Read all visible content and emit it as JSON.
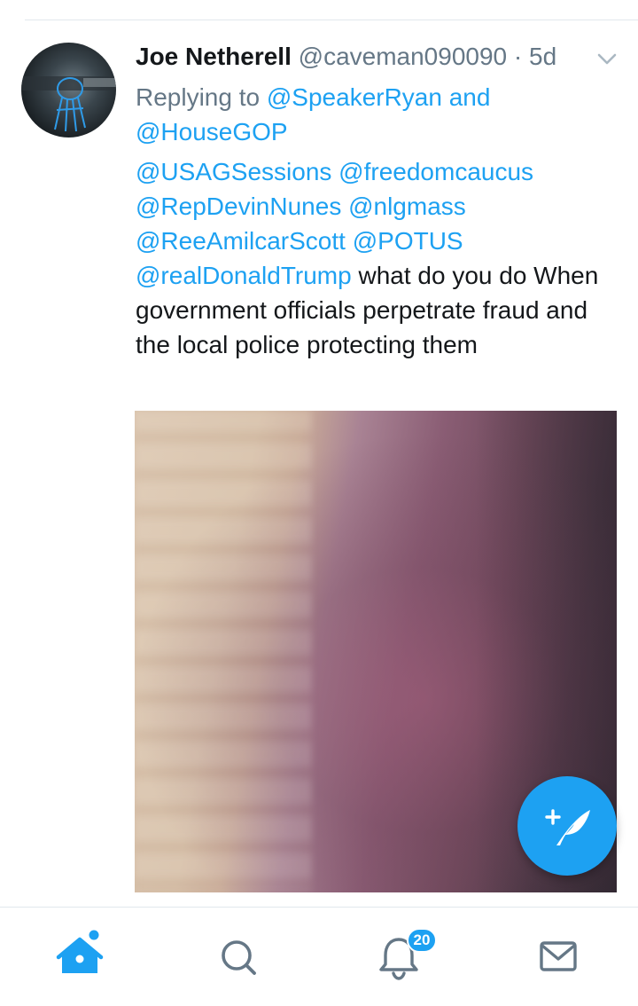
{
  "tweet": {
    "author_name": "Joe Netherell",
    "author_handle": "@caveman090090",
    "separator": "·",
    "time": "5d",
    "replying_prefix": "Replying to",
    "replying_to_1": "@SpeakerRyan",
    "replying_and": "and",
    "replying_to_2": "@HouseGOP",
    "mentions": [
      "@USAGSessions",
      "@freedomcaucus",
      "@RepDevinNunes",
      "@nlgmass",
      "@ReeAmilcarScott",
      "@POTUS",
      "@realDonaldTrump"
    ],
    "body": "what do you do When government officials perpetrate fraud and the local police protecting them"
  },
  "nav": {
    "notifications_badge": "20"
  },
  "colors": {
    "accent": "#1da1f2",
    "text": "#14171a",
    "secondary_text": "#657786",
    "divider": "#e1e8ed"
  },
  "icons": {
    "avatar": "avatar-image",
    "caret": "chevron-down-icon",
    "compose": "compose-tweet-icon",
    "home": "home-icon",
    "search": "search-icon",
    "notifications": "bell-icon",
    "messages": "envelope-icon"
  }
}
